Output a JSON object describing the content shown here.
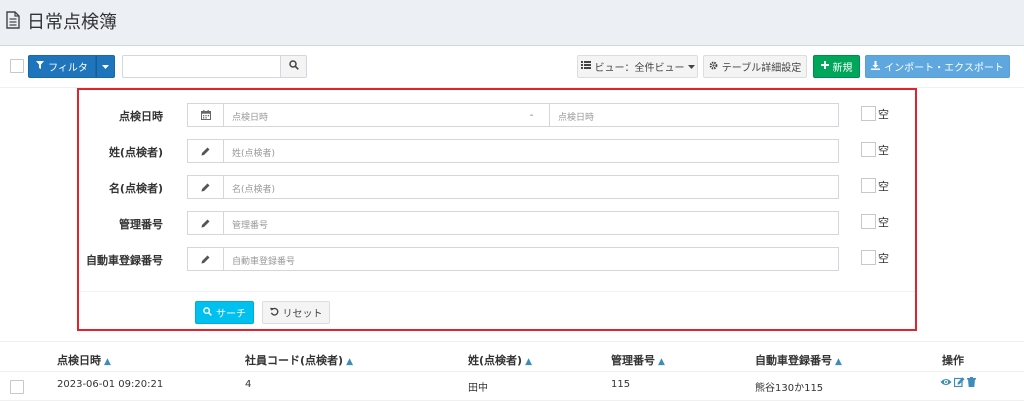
{
  "header": {
    "title": "日常点検簿",
    "icon": "document-icon"
  },
  "toolbar": {
    "filter_label": "フィルタ",
    "search_placeholder": "",
    "view_label": "ビュー：全件ビュー",
    "table_settings_label": "テーブル詳細設定",
    "new_label": "新規",
    "import_export_label": "インポート・エクスポート"
  },
  "filter": {
    "rows": [
      {
        "label": "点検日時",
        "icon": "calendar-icon",
        "placeholder": "点検日時",
        "to_placeholder": "点検日時",
        "separator": "-",
        "empty_label": "空"
      },
      {
        "label": "姓(点検者)",
        "icon": "pencil-icon",
        "placeholder": "姓(点検者)",
        "empty_label": "空"
      },
      {
        "label": "名(点検者)",
        "icon": "pencil-icon",
        "placeholder": "名(点検者)",
        "empty_label": "空"
      },
      {
        "label": "管理番号",
        "icon": "pencil-icon",
        "placeholder": "管理番号",
        "empty_label": "空"
      },
      {
        "label": "自動車登録番号",
        "icon": "pencil-icon",
        "placeholder": "自動車登録番号",
        "empty_label": "空"
      }
    ],
    "search_label": "サーチ",
    "reset_label": "リセット"
  },
  "table": {
    "columns": [
      "点検日時",
      "社員コード(点検者)",
      "姓(点検者)",
      "管理番号",
      "自動車登録番号",
      "操作"
    ],
    "rows": [
      [
        "2023-06-01 09:20:21",
        "4",
        "田中",
        "115",
        "熊谷130か115"
      ]
    ]
  },
  "colors": {
    "primary": "#1f75bb",
    "success": "#00a65a",
    "info": "#00c0ef",
    "highlight": "#e0242b",
    "sort": "#3c8dbc"
  }
}
